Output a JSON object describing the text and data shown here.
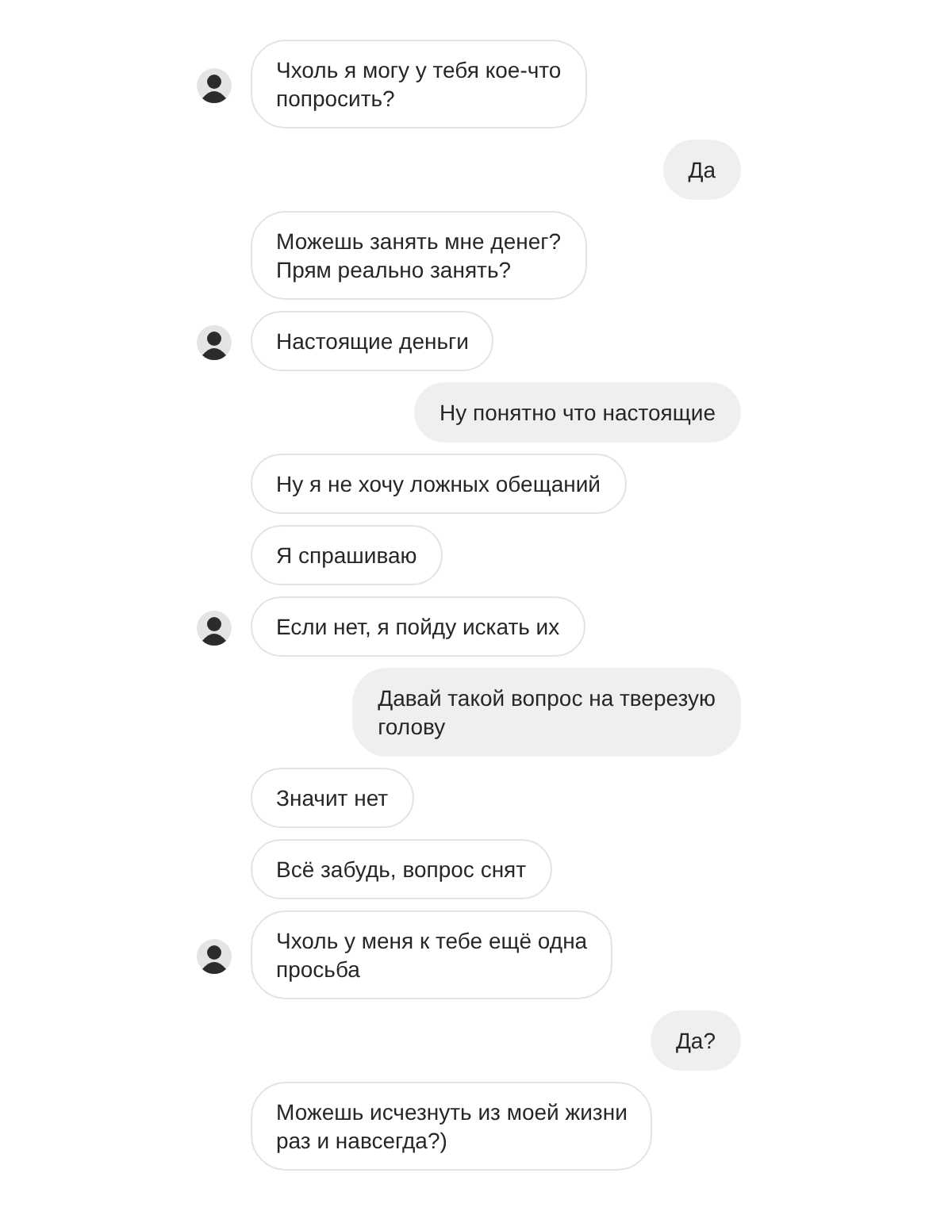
{
  "messages": [
    {
      "kind": "incoming",
      "text": "Чхоль я могу у тебя кое-что\nпопросить?",
      "avatar": true
    },
    {
      "kind": "outgoing",
      "text": "Да",
      "avatar": false
    },
    {
      "kind": "incoming",
      "text": "Можешь занять мне денег?\nПрям реально занять?",
      "avatar": false
    },
    {
      "kind": "incoming",
      "text": "Настоящие деньги",
      "avatar": true
    },
    {
      "kind": "outgoing",
      "text": "Ну понятно что настоящие",
      "avatar": false
    },
    {
      "kind": "incoming",
      "text": "Ну я не хочу ложных обещаний",
      "avatar": false
    },
    {
      "kind": "incoming",
      "text": "Я спрашиваю",
      "avatar": false
    },
    {
      "kind": "incoming",
      "text": "Если нет, я пойду искать их",
      "avatar": true
    },
    {
      "kind": "outgoing",
      "text": "Давай такой вопрос на тверезую\nголову",
      "avatar": false
    },
    {
      "kind": "incoming",
      "text": "Значит нет",
      "avatar": false
    },
    {
      "kind": "incoming",
      "text": "Всё забудь, вопрос снят",
      "avatar": false
    },
    {
      "kind": "incoming",
      "text": "Чхоль у меня к тебе ещё одна\nпросьба",
      "avatar": true
    },
    {
      "kind": "outgoing",
      "text": "Да?",
      "avatar": false
    },
    {
      "kind": "incoming",
      "text": "Можешь исчезнуть из моей жизни\nраз и навсегда?)",
      "avatar": false
    }
  ]
}
